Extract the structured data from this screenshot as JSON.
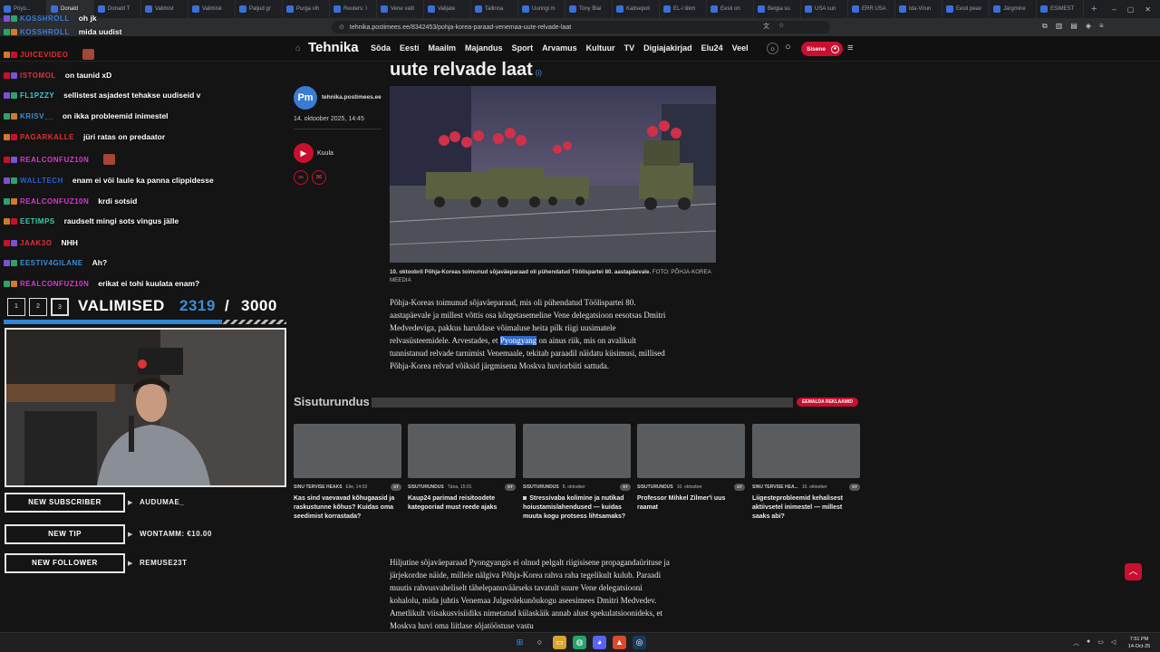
{
  "browser": {
    "tabs": [
      {
        "label": "Pöyü..."
      },
      {
        "label": "Donald"
      },
      {
        "label": "Donald T"
      },
      {
        "label": "Valimist"
      },
      {
        "label": "Valimisk"
      },
      {
        "label": "Paljud gr"
      },
      {
        "label": "Purga vih"
      },
      {
        "label": "Reuters: I"
      },
      {
        "label": "Vene valit"
      },
      {
        "label": "Valijate"
      },
      {
        "label": "Tallinna"
      },
      {
        "label": "Uuringi m"
      },
      {
        "label": "Tony Blai"
      },
      {
        "label": "Kaitsepoli"
      },
      {
        "label": "EL-i liikm"
      },
      {
        "label": "Eesti on"
      },
      {
        "label": "Belgia su"
      },
      {
        "label": "USA sun"
      },
      {
        "label": "ERR USA"
      },
      {
        "label": "Ida-Virun"
      },
      {
        "label": "Eesti peav"
      },
      {
        "label": "Järgmine"
      },
      {
        "label": "ESIMEST"
      }
    ],
    "url": "tehnika.postimees.ee/8342453/pohja-korea-paraad-venemaa-uute-relvade-laat"
  },
  "site": {
    "logo": "Tehnika",
    "nav": [
      "Sõda",
      "Eesti",
      "Maailm",
      "Majandus",
      "Sport",
      "Arvamus",
      "Kultuur",
      "TV",
      "Digiajakirjad",
      "Elu24",
      "Veel"
    ],
    "login_label": "Sisene"
  },
  "article": {
    "headline": "uute relvade laat",
    "headline_sup": "(i)",
    "author_logo": "Pm",
    "author": "tehnika.postimees.ee",
    "date": "14. oktoober 2025, 14:45",
    "listen_label": "Kuula",
    "caption": "10. oktoobril Põhja-Koreas toimunud sõjaväeparaad oli pühendatud Töölispartei 80. aastapäevale.",
    "caption_credit": "FOTO: PÕHJA-KOREA MEEDIA",
    "para1_before": "Põhja-Koreas toimunud sõjaväeparaad, mis oli pühendatud Töölispartei 80. aastapäevale ja millest võttis osa kõrgetasemeline Vene delegatsioon eesotsas Dmitri Medvedeviga, pakkus haruldase võimaluse heita pilk riigi uusimatele relvasüsteemidele. Arvestades, et ",
    "para1_highlight": "Pyongyang",
    "para1_after": " on ainus riik, mis on avalikult tunnistanud relvade tarnimist Venemaale, tekitab paraadil näidatu küsimusi, millised Põhja-Korea relvad võiksid järgmisena Moskva huviorbiiti sattuda.",
    "para2": "Hiljutine sõjaväeparaad Pyongyangis ei olnud pelgalt riigisisene propagandaürituse ja järjekordne näide, millele nälgiva Põhja-Korea rahva raha tegelikult kulub. Paraadi muutis rahvusvaheliselt tähelepanuväärseks tavatult suure Vene delegatsiooni kohalolu, mida juhtis Venemaa Julgeolekunõukogu aseesimees Dmitri Medvedev. Ametlikult viisakusvisiidiks nimetatud külaskäik annab alust spekulatsioonideks, et Moskva huvi oma liitlase sõjatööstuse vastu"
  },
  "promo": {
    "title": "Sisuturundus",
    "remove_ads": "EEMALDA REKLAAMID",
    "cards": [
      {
        "category": "SINU TERVISE HEAKS",
        "date": "Eile, 14:03",
        "badge": "ST",
        "title": "Kas sind vaevavad kõhugaasid ja raskustunne kõhus? Kuidas oma seedimist korrastada?"
      },
      {
        "category": "SISUTURUNDUS",
        "date": "Täna, 15:01",
        "badge": "ST",
        "title": "Kaup24 parimad reisitoodete kategooriad must reede ajaks"
      },
      {
        "category": "SISUTURUNDUS",
        "date": "8. oktoober",
        "badge": "ST",
        "title": "Stressivaba kolimine ja nutikad hoiustamislahendused — kuidas muuta kogu protsess lihtsamaks?"
      },
      {
        "category": "SISUTURUNDUS",
        "date": "10. oktoober",
        "badge": "ST",
        "title": "Professor Mihkel Zilmer'i uus raamat"
      },
      {
        "category": "SINU TERVISE HEA...",
        "date": "10. oktoober",
        "badge": "ST",
        "title": "Liigesteprobleemid kehalisest aktiivsetel inimestel — millest saaks abi?"
      }
    ]
  },
  "stream": {
    "chat": [
      {
        "user": "KOSSHROLL",
        "msg": "oh jk",
        "color": "#3a7bd5"
      },
      {
        "user": "KOSSHROLL",
        "msg": "mida uudist",
        "color": "#3a7bd5"
      },
      {
        "user": "JUICEVIDEO",
        "msg": "",
        "color": "#e0303a",
        "emote": true
      },
      {
        "user": "ISTOMOL",
        "msg": "on taunid xD",
        "color": "#e0303a"
      },
      {
        "user": "FL1PZZY",
        "msg": "sellistest asjadest tehakse uudiseid v",
        "color": "#3ec9d6"
      },
      {
        "user": "KRISV__",
        "msg": "on ikka probleemid inimestel",
        "color": "#3a8fd6"
      },
      {
        "user": "PAGARKALLE",
        "msg": "jüri ratas on predaator",
        "color": "#e0303a"
      },
      {
        "user": "REALCONFUZ10N",
        "msg": "",
        "color": "#d838d0",
        "emote": true
      },
      {
        "user": "WALLTECH",
        "msg": "enam ei vöi laule ka panna clippidesse",
        "color": "#2a5fd0"
      },
      {
        "user": "REALCONFUZ10N",
        "msg": "krdi sotsid",
        "color": "#d838d0"
      },
      {
        "user": "EETIMPS",
        "msg": "raudselt mingi sots vingus jälle",
        "color": "#3ec9a6"
      },
      {
        "user": "JAAK3O",
        "msg": "NHH",
        "color": "#e0303a"
      },
      {
        "user": "EESTIV4GILANE",
        "msg": "Ah?",
        "color": "#3a8fd6"
      },
      {
        "user": "REALCONFUZ10N",
        "msg": "erikat ei tohi kuulata enam?",
        "color": "#d838d0"
      }
    ],
    "goal": {
      "steps": [
        "1",
        "2",
        "3"
      ],
      "label": "VALIMISED",
      "current": "2319",
      "separator": "/",
      "target": "3000",
      "progress_fraction": 0.773
    },
    "alerts": [
      {
        "label": "NEW SUBSCRIBER",
        "value": "AUDUMAE_"
      },
      {
        "label": "NEW TIP",
        "value": "WONTAMM: €10.00"
      },
      {
        "label": "NEW FOLLOWER",
        "value": "REMUSE23T"
      }
    ]
  },
  "taskbar": {
    "time": "7:51 PM",
    "date": "14-Oct-25"
  }
}
